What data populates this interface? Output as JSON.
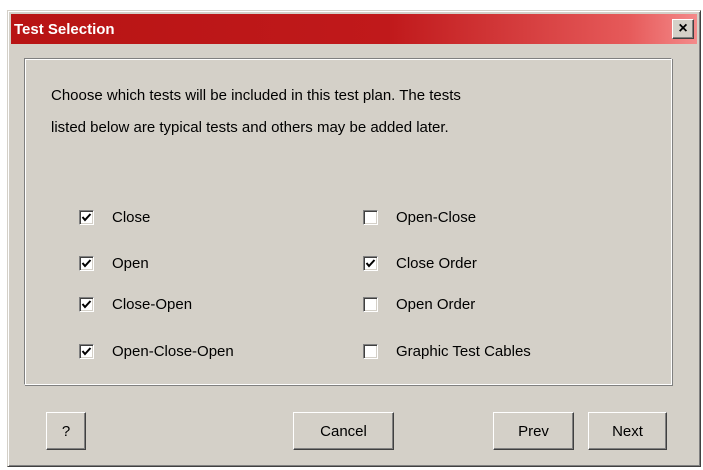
{
  "window": {
    "title": "Test Selection",
    "close_glyph": "×",
    "title_gradient": [
      "#b81414",
      "#f48a8a"
    ],
    "background": "#d4d0c8"
  },
  "instructions": {
    "line1": "Choose which tests will be included in this test plan. The tests",
    "line2": "listed below are typical tests and others may be added later."
  },
  "tests": [
    {
      "label": "Close",
      "checked": true
    },
    {
      "label": "Open",
      "checked": true
    },
    {
      "label": "Close-Open",
      "checked": true
    },
    {
      "label": "Open-Close-Open",
      "checked": true
    },
    {
      "label": "Open-Close",
      "checked": false
    },
    {
      "label": "Close Order",
      "checked": true
    },
    {
      "label": "Open Order",
      "checked": false
    },
    {
      "label": "Graphic Test Cables",
      "checked": false
    }
  ],
  "buttons": {
    "help": "?",
    "cancel": "Cancel",
    "prev": "Prev",
    "next": "Next"
  }
}
